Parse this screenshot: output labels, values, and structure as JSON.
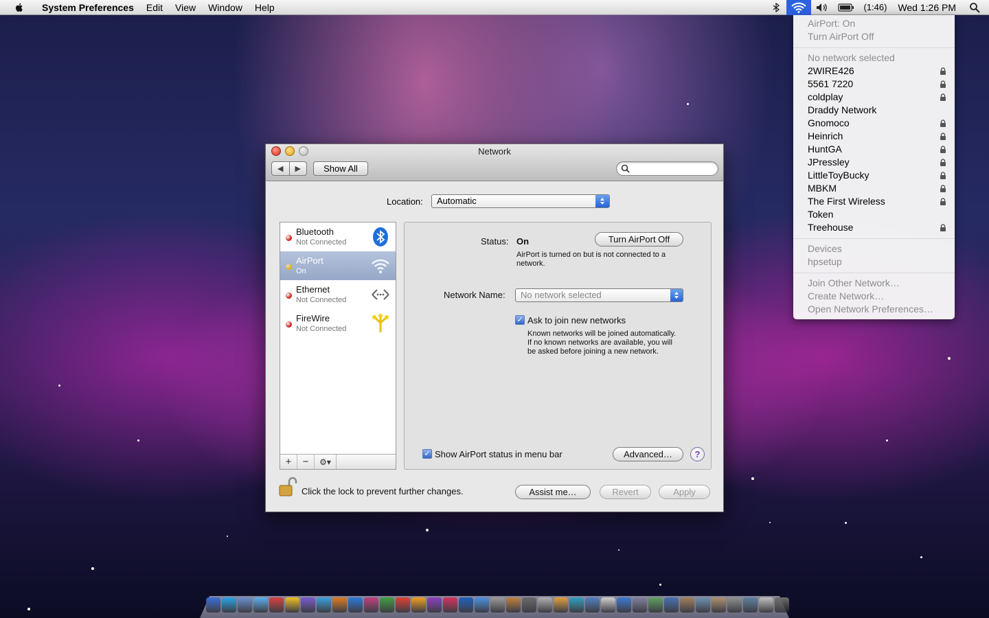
{
  "menubar": {
    "app_name": "System Preferences",
    "menus": [
      "Edit",
      "View",
      "Window",
      "Help"
    ],
    "battery": "(1:46)",
    "clock": "Wed 1:26 PM"
  },
  "airport_menu": {
    "status": "AirPort: On",
    "toggle": "Turn AirPort Off",
    "no_network": "No network selected",
    "networks": [
      {
        "name": "2WIRE426",
        "locked": true
      },
      {
        "name": "5561 7220",
        "locked": true
      },
      {
        "name": "coldplay",
        "locked": true
      },
      {
        "name": "Draddy Network",
        "locked": false
      },
      {
        "name": "Gnomoco",
        "locked": true
      },
      {
        "name": "Heinrich",
        "locked": true
      },
      {
        "name": "HuntGA",
        "locked": true
      },
      {
        "name": "JPressley",
        "locked": true
      },
      {
        "name": "LittleToyBucky",
        "locked": true
      },
      {
        "name": "MBKM",
        "locked": true
      },
      {
        "name": "The First Wireless",
        "locked": true
      },
      {
        "name": "Token",
        "locked": false
      },
      {
        "name": "Treehouse",
        "locked": true
      }
    ],
    "devices_header": "Devices",
    "device": "hpsetup",
    "join_other": "Join Other Network…",
    "create": "Create Network…",
    "open_prefs": "Open Network Preferences…"
  },
  "window": {
    "title": "Network",
    "show_all": "Show All",
    "location_label": "Location:",
    "location_value": "Automatic",
    "services": [
      {
        "name": "Bluetooth",
        "status": "Not Connected",
        "dot": "#d0201a"
      },
      {
        "name": "AirPort",
        "status": "On",
        "dot": "#e6b200"
      },
      {
        "name": "Ethernet",
        "status": "Not Connected",
        "dot": "#d0201a"
      },
      {
        "name": "FireWire",
        "status": "Not Connected",
        "dot": "#d0201a"
      }
    ],
    "status_label": "Status:",
    "status_value": "On",
    "turn_off_button": "Turn AirPort Off",
    "status_desc": "AirPort is turned on but is not connected to a network.",
    "network_name_label": "Network Name:",
    "network_name_value": "No network selected",
    "ask_join_label": "Ask to join new networks",
    "ask_join_desc": "Known networks will be joined automatically. If no known networks are available, you will be asked before joining a new network.",
    "show_status_label": "Show AirPort status in menu bar",
    "advanced_button": "Advanced…",
    "help": "?",
    "lock_text": "Click the lock to prevent further changes.",
    "assist_button": "Assist me…",
    "revert_button": "Revert",
    "apply_button": "Apply"
  }
}
